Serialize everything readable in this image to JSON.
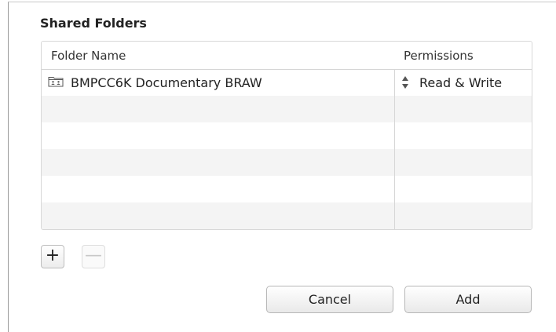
{
  "dialog": {
    "title": "Shared Folders"
  },
  "table": {
    "columns": [
      "Folder Name",
      "Permissions"
    ],
    "rows": [
      {
        "folder_name": "BMPCC6K Documentary BRAW",
        "permissions": "Read & Write",
        "icon": "shared-folder-icon",
        "perm_icon": "up-down-stepper-icon"
      }
    ],
    "empty_rows": 5
  },
  "buttons": {
    "add_row": "+",
    "remove_row": "—",
    "cancel": "Cancel",
    "add": "Add"
  },
  "colors": {
    "alt_row": "#f4f4f4",
    "border": "#d6d6d6",
    "disabled": "#c8c8c8"
  }
}
